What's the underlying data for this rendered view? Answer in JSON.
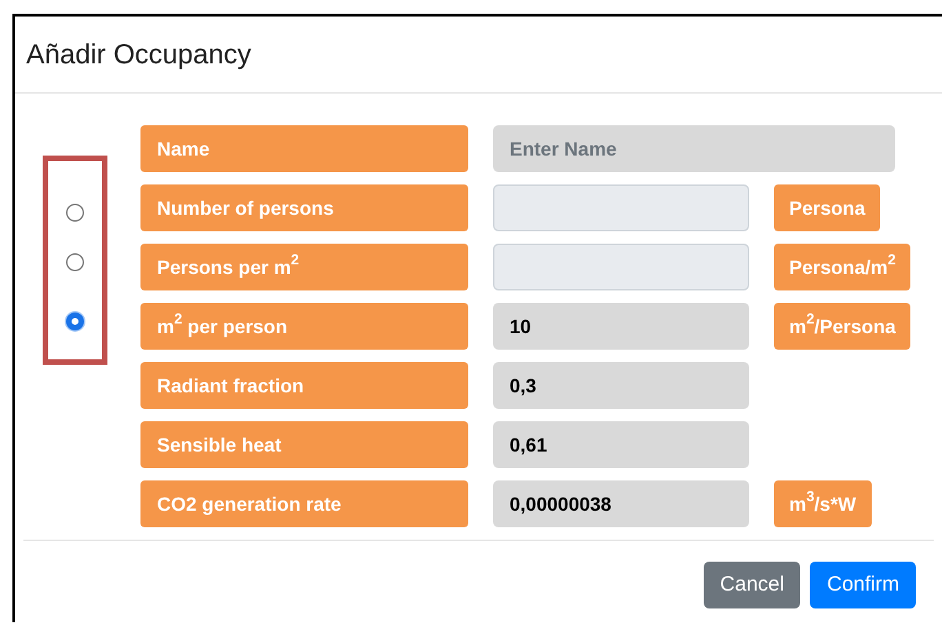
{
  "dialog": {
    "title": "Añadir Occupancy"
  },
  "rows": [
    {
      "label": "Name",
      "placeholder": "Enter Name",
      "disabled": true,
      "wide": true
    },
    {
      "label": "Number of persons",
      "value": "",
      "disabled": false,
      "unit": "Persona",
      "radio": {
        "selected": false
      }
    },
    {
      "label": "Persons per m$^{2}$",
      "value": "",
      "disabled": false,
      "unit": "Persona/m$^{2}$",
      "radio": {
        "selected": false
      }
    },
    {
      "label": "m$^{2}$ per person",
      "value": "10",
      "disabled": true,
      "unit": "m$^{2}$/Persona",
      "radio": {
        "selected": true
      }
    },
    {
      "label": "Radiant fraction",
      "value": "0,3",
      "disabled": true
    },
    {
      "label": "Sensible heat",
      "value": "0,61",
      "disabled": true
    },
    {
      "label": "CO2 generation rate",
      "value": "0,00000038",
      "disabled": true,
      "unit": "m$^{3}$/s*W"
    }
  ],
  "buttons": [
    {
      "label": "Cancel",
      "kind": "secondary"
    },
    {
      "label": "Confirm",
      "kind": "primary"
    }
  ]
}
